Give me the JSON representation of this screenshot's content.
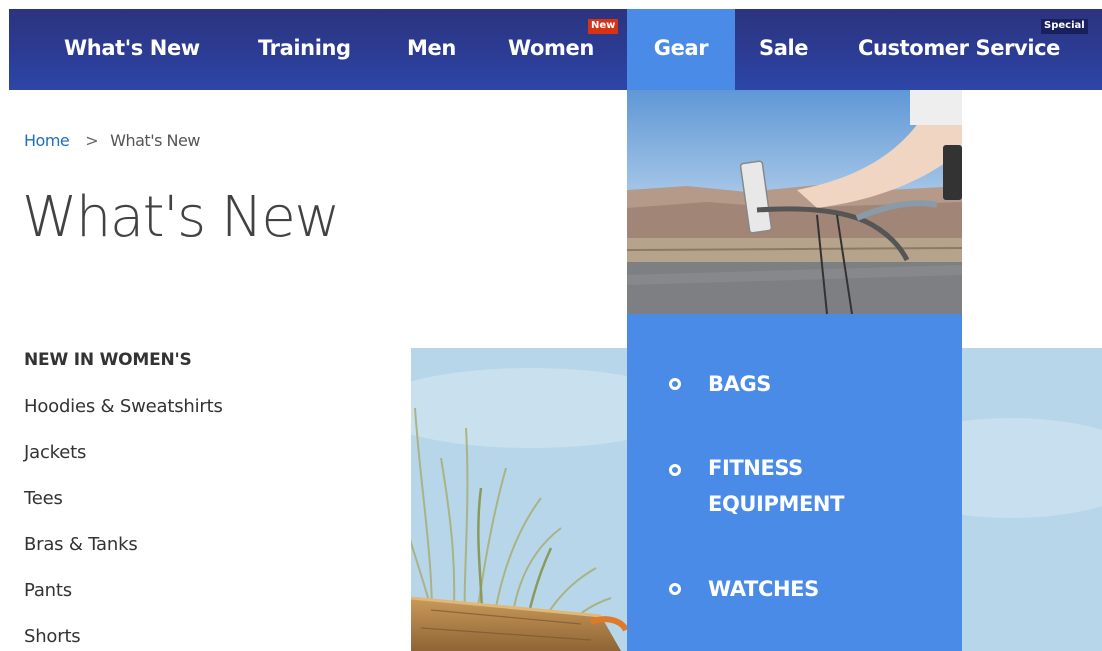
{
  "nav": {
    "items": [
      {
        "label": "What's New"
      },
      {
        "label": "Training"
      },
      {
        "label": "Men"
      },
      {
        "label": "Women",
        "badge": "New"
      },
      {
        "label": "Gear",
        "active": true
      },
      {
        "label": "Sale"
      },
      {
        "label": "Customer Service",
        "badge": "Special"
      }
    ],
    "background": "#2c3c94",
    "active_color": "#4b8be8",
    "badge_new_color": "#d63316",
    "badge_special_color": "#1a1f5e"
  },
  "breadcrumb": {
    "home": "Home",
    "separator": ">",
    "current": "What's New"
  },
  "page_title": "What's New",
  "sidebar": {
    "heading": "NEW IN WOMEN'S",
    "links": [
      "Hoodies & Sweatshirts",
      "Jackets",
      "Tees",
      "Bras & Tanks",
      "Pants",
      "Shorts"
    ]
  },
  "dropdown": {
    "items": [
      {
        "label_lines": [
          "BAGS"
        ]
      },
      {
        "label_lines": [
          "FITNESS",
          "EQUIPMENT"
        ]
      },
      {
        "label_lines": [
          "WATCHES"
        ]
      }
    ],
    "bullet_icon": "circle-bullet-icon"
  }
}
